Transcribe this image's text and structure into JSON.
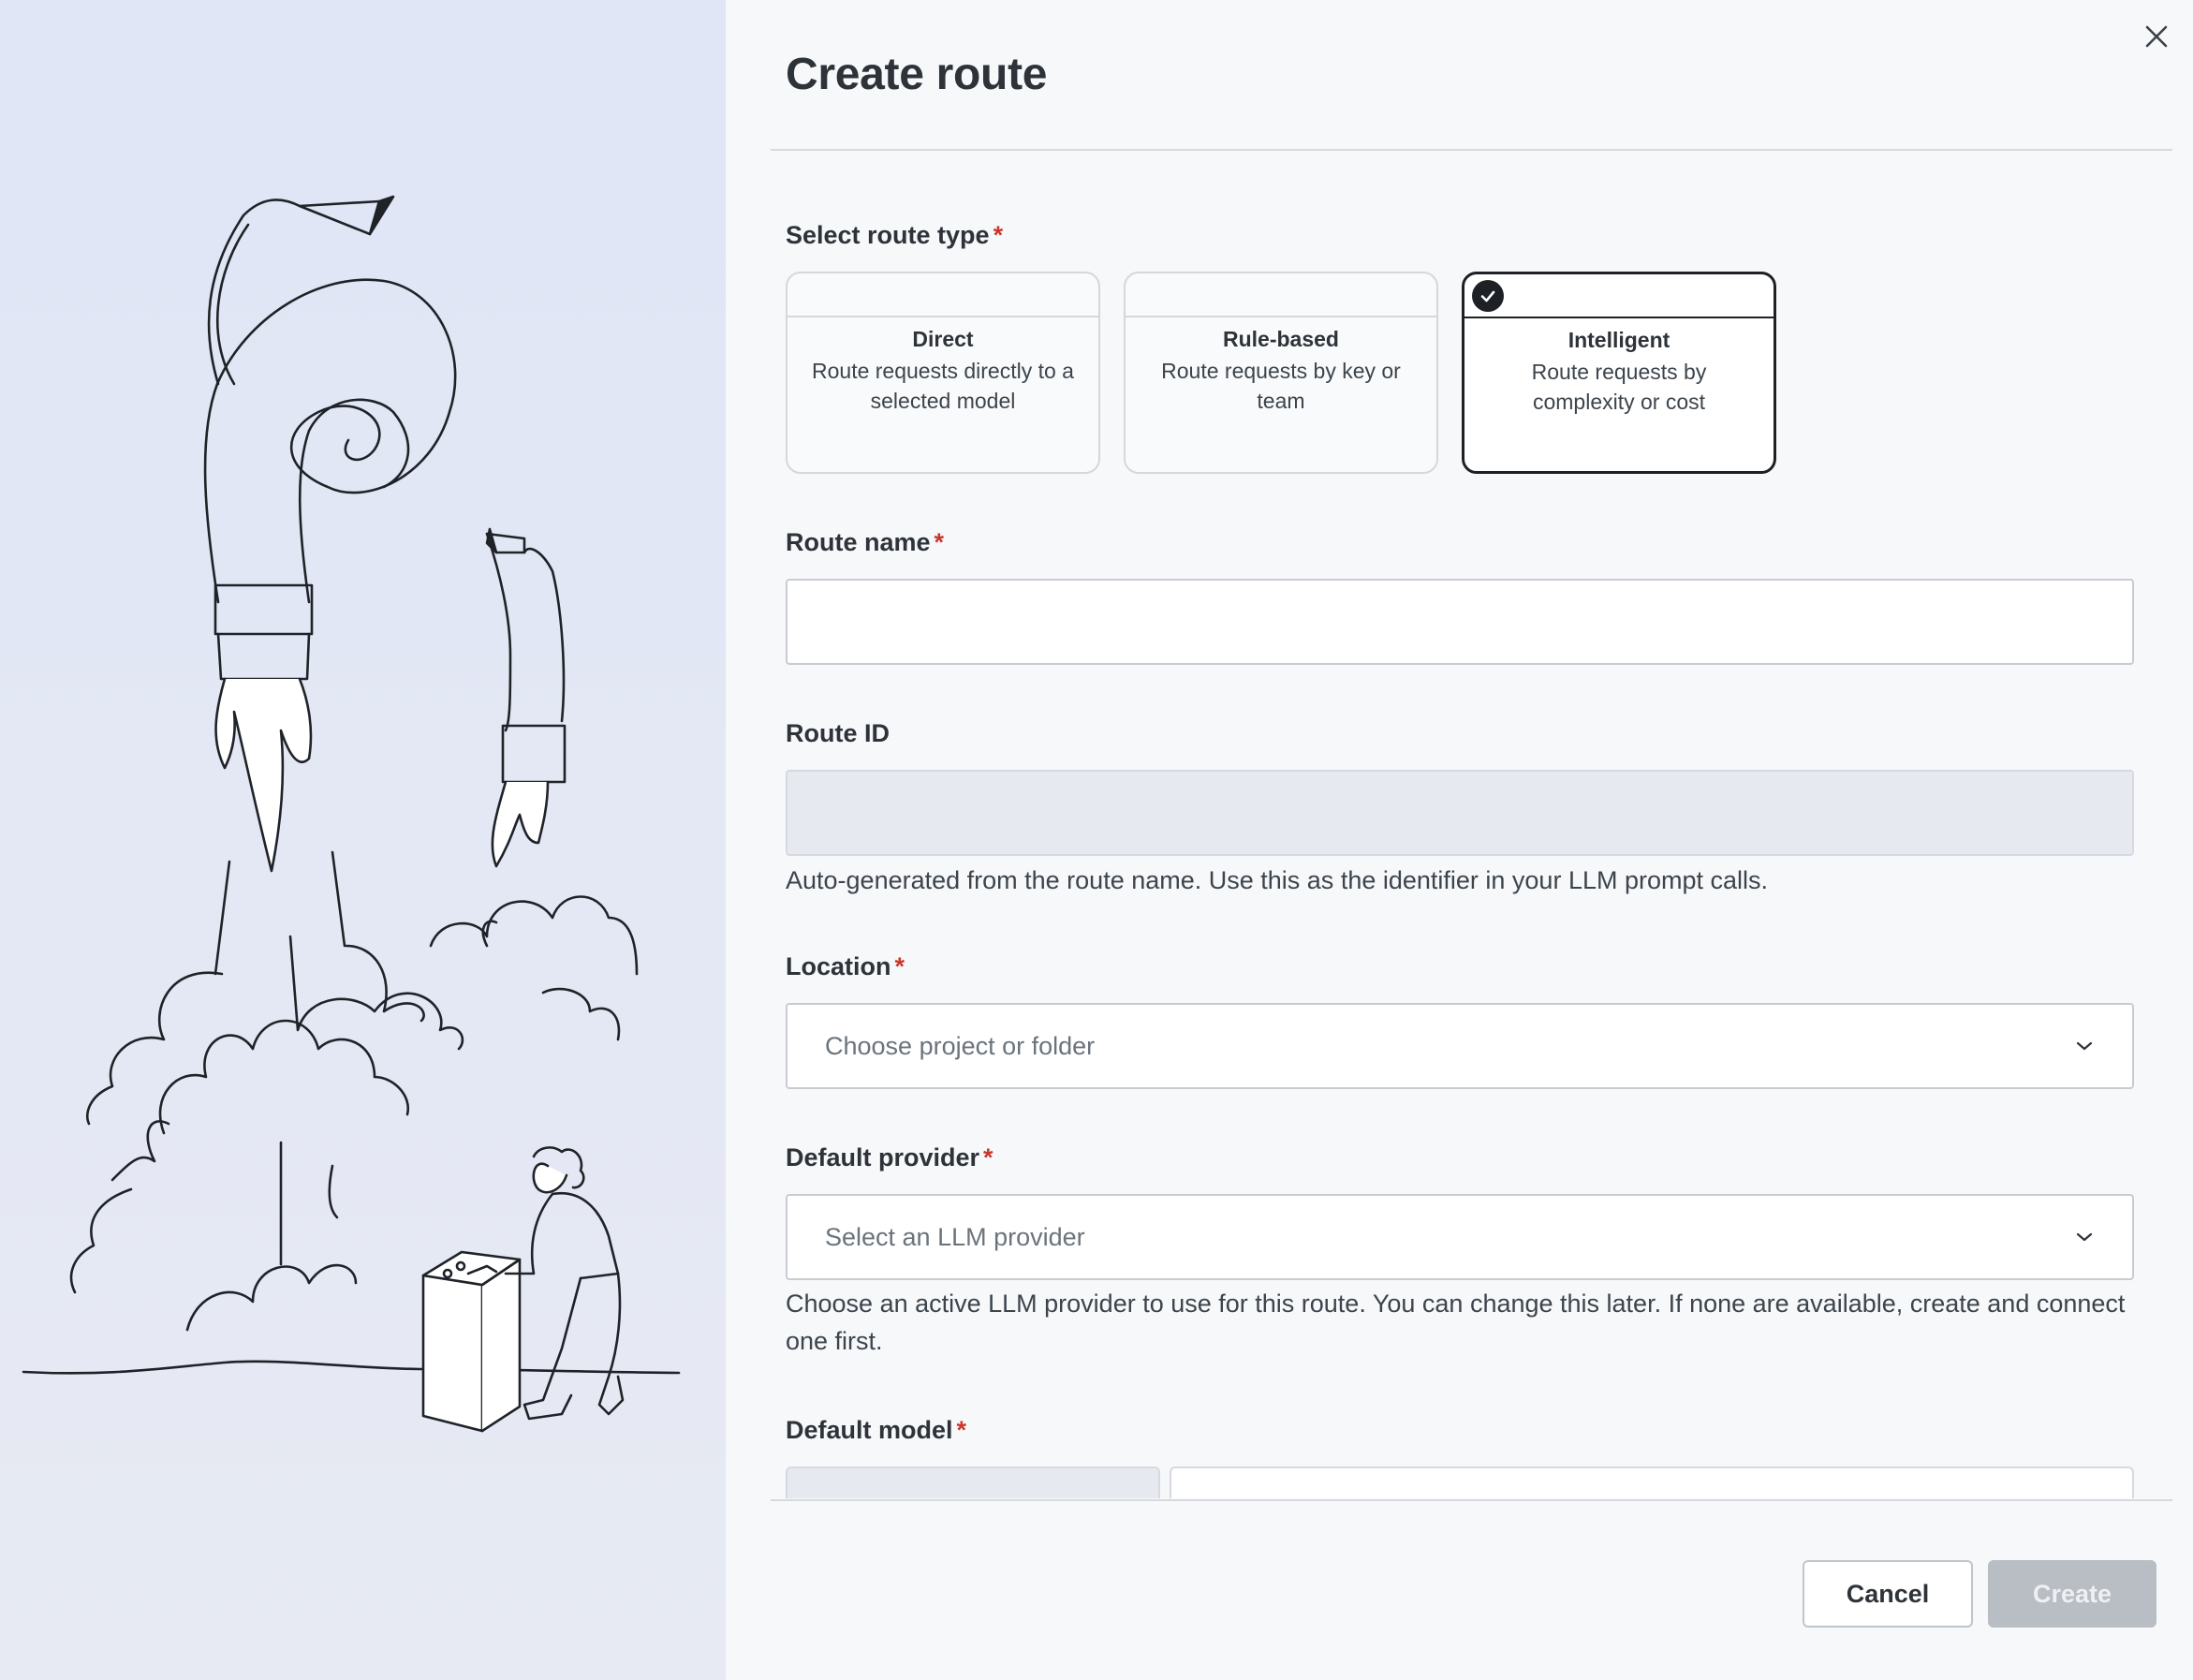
{
  "dialog": {
    "title": "Create route",
    "close_icon": "close-icon"
  },
  "route_type": {
    "label": "Select route type",
    "required_mark": "*",
    "options": [
      {
        "name": "Direct",
        "description": "Route requests directly to a selected model",
        "selected": false
      },
      {
        "name": "Rule-based",
        "description": "Route requests by key or team",
        "selected": false
      },
      {
        "name": "Intelligent",
        "description": "Route requests by complexity or cost",
        "selected": true
      }
    ],
    "selected_icon": "check-circle-icon"
  },
  "route_name": {
    "label": "Route name",
    "required_mark": "*",
    "value": "",
    "placeholder": ""
  },
  "route_id": {
    "label": "Route ID",
    "value": "",
    "helper": "Auto-generated from the route name. Use this as the identifier in your LLM prompt calls."
  },
  "location": {
    "label": "Location",
    "required_mark": "*",
    "placeholder": "Choose project or folder",
    "icon": "chevron-down-icon"
  },
  "default_provider": {
    "label": "Default provider",
    "required_mark": "*",
    "placeholder": "Select an LLM provider",
    "icon": "chevron-down-icon",
    "helper": "Choose an active LLM provider to use for this route. You can change this later. If none are available, create and connect one first."
  },
  "default_model": {
    "label": "Default model",
    "required_mark": "*"
  },
  "footer": {
    "cancel_label": "Cancel",
    "create_label": "Create",
    "create_disabled": true
  },
  "colors": {
    "required": "#c9372c",
    "selected_border": "#1d2125",
    "disabled_button": "#b9bdc4",
    "illustration_bg": "#e0e6f6"
  }
}
